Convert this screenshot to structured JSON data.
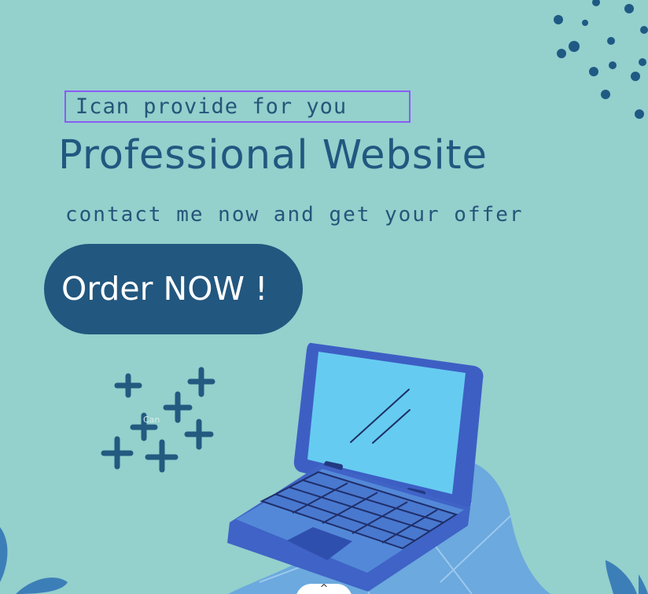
{
  "hero": {
    "tagline": "Ican provide for you",
    "headline": "Professional Website",
    "subline": "contact me now and get your offer",
    "order_button": "Order NOW !"
  },
  "scroll_up": {
    "icon": "chevron-up-icon",
    "glyph": "^"
  },
  "colors": {
    "background": "#94d0cc",
    "brand_dark": "#22577f",
    "selection_outline": "#8a5cf6",
    "laptop_body": "#3f63c6",
    "laptop_screen": "#66cbf1",
    "floor_shape": "#6ba9de"
  }
}
